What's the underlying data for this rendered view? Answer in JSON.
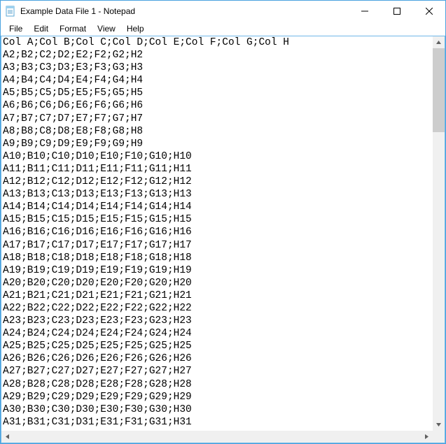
{
  "window": {
    "title": "Example Data File 1 - Notepad"
  },
  "menu": {
    "file": "File",
    "edit": "Edit",
    "format": "Format",
    "view": "View",
    "help": "Help"
  },
  "editor": {
    "lines": [
      "Col A;Col B;Col C;Col D;Col E;Col F;Col G;Col H",
      "A2;B2;C2;D2;E2;F2;G2;H2",
      "A3;B3;C3;D3;E3;F3;G3;H3",
      "A4;B4;C4;D4;E4;F4;G4;H4",
      "A5;B5;C5;D5;E5;F5;G5;H5",
      "A6;B6;C6;D6;E6;F6;G6;H6",
      "A7;B7;C7;D7;E7;F7;G7;H7",
      "A8;B8;C8;D8;E8;F8;G8;H8",
      "A9;B9;C9;D9;E9;F9;G9;H9",
      "A10;B10;C10;D10;E10;F10;G10;H10",
      "A11;B11;C11;D11;E11;F11;G11;H11",
      "A12;B12;C12;D12;E12;F12;G12;H12",
      "A13;B13;C13;D13;E13;F13;G13;H13",
      "A14;B14;C14;D14;E14;F14;G14;H14",
      "A15;B15;C15;D15;E15;F15;G15;H15",
      "A16;B16;C16;D16;E16;F16;G16;H16",
      "A17;B17;C17;D17;E17;F17;G17;H17",
      "A18;B18;C18;D18;E18;F18;G18;H18",
      "A19;B19;C19;D19;E19;F19;G19;H19",
      "A20;B20;C20;D20;E20;F20;G20;H20",
      "A21;B21;C21;D21;E21;F21;G21;H21",
      "A22;B22;C22;D22;E22;F22;G22;H22",
      "A23;B23;C23;D23;E23;F23;G23;H23",
      "A24;B24;C24;D24;E24;F24;G24;H24",
      "A25;B25;C25;D25;E25;F25;G25;H25",
      "A26;B26;C26;D26;E26;F26;G26;H26",
      "A27;B27;C27;D27;E27;F27;G27;H27",
      "A28;B28;C28;D28;E28;F28;G28;H28",
      "A29;B29;C29;D29;E29;F29;G29;H29",
      "A30;B30;C30;D30;E30;F30;G30;H30",
      "A31;B31;C31;D31;E31;F31;G31;H31"
    ]
  }
}
